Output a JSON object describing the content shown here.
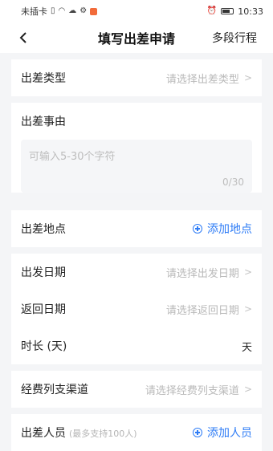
{
  "status_bar": {
    "carrier": "未插卡",
    "time": "10:33"
  },
  "header": {
    "title": "填写出差申请",
    "right_action": "多段行程"
  },
  "form": {
    "trip_type": {
      "label": "出差类型",
      "placeholder": "请选择出差类型"
    },
    "reason": {
      "label": "出差事由",
      "placeholder": "可输入5-30个字符",
      "counter": "0/30"
    },
    "location": {
      "label": "出差地点",
      "action": "添加地点"
    },
    "depart": {
      "label": "出发日期",
      "placeholder": "请选择出发日期"
    },
    "return": {
      "label": "返回日期",
      "placeholder": "请选择返回日期"
    },
    "duration": {
      "label": "时长 (天)",
      "unit": "天"
    },
    "expense": {
      "label": "经费列支渠道",
      "placeholder": "请选择经费列支渠道"
    },
    "people": {
      "label": "出差人员",
      "note": "(最多支持100人)",
      "action": "添加人员"
    }
  },
  "colors": {
    "accent": "#2e7cf6",
    "background": "#f4f5f7"
  }
}
